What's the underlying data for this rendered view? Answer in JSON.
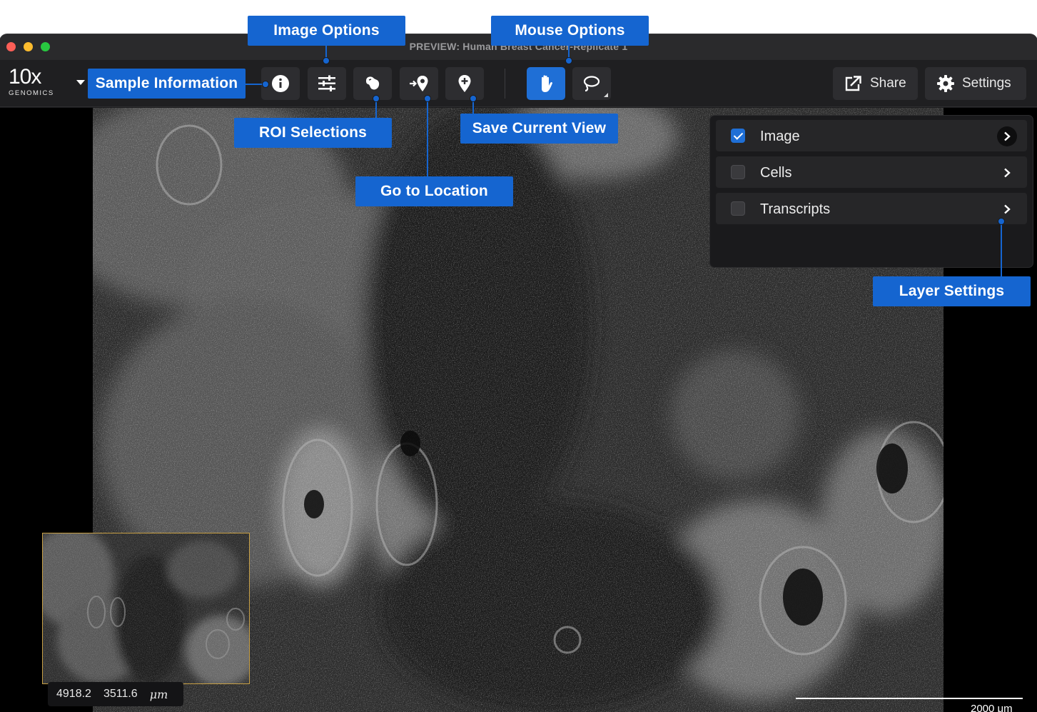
{
  "window": {
    "title": "PREVIEW: Human Breast Cancer-Replicate 1"
  },
  "logo": {
    "main": "10",
    "x": "x",
    "sub": "GENOMICS"
  },
  "toolbar": {
    "share_label": "Share",
    "settings_label": "Settings"
  },
  "layers": [
    {
      "label": "Image",
      "checked": true
    },
    {
      "label": "Cells",
      "checked": false
    },
    {
      "label": "Transcripts",
      "checked": false
    }
  ],
  "coords": {
    "x": "4918.2",
    "y": "3511.6",
    "unit": "μm"
  },
  "scale": {
    "label": "2000 μm"
  },
  "callouts": {
    "image_options": "Image Options",
    "mouse_options": "Mouse Options",
    "sample_information": "Sample Information",
    "roi_selections": "ROI Selections",
    "save_current_view": "Save Current View",
    "go_to_location": "Go to Location",
    "layer_settings": "Layer Settings"
  },
  "colors": {
    "accent": "#1565d0",
    "active_button": "#1f6fd6",
    "minimap_border": "#c8a045"
  }
}
